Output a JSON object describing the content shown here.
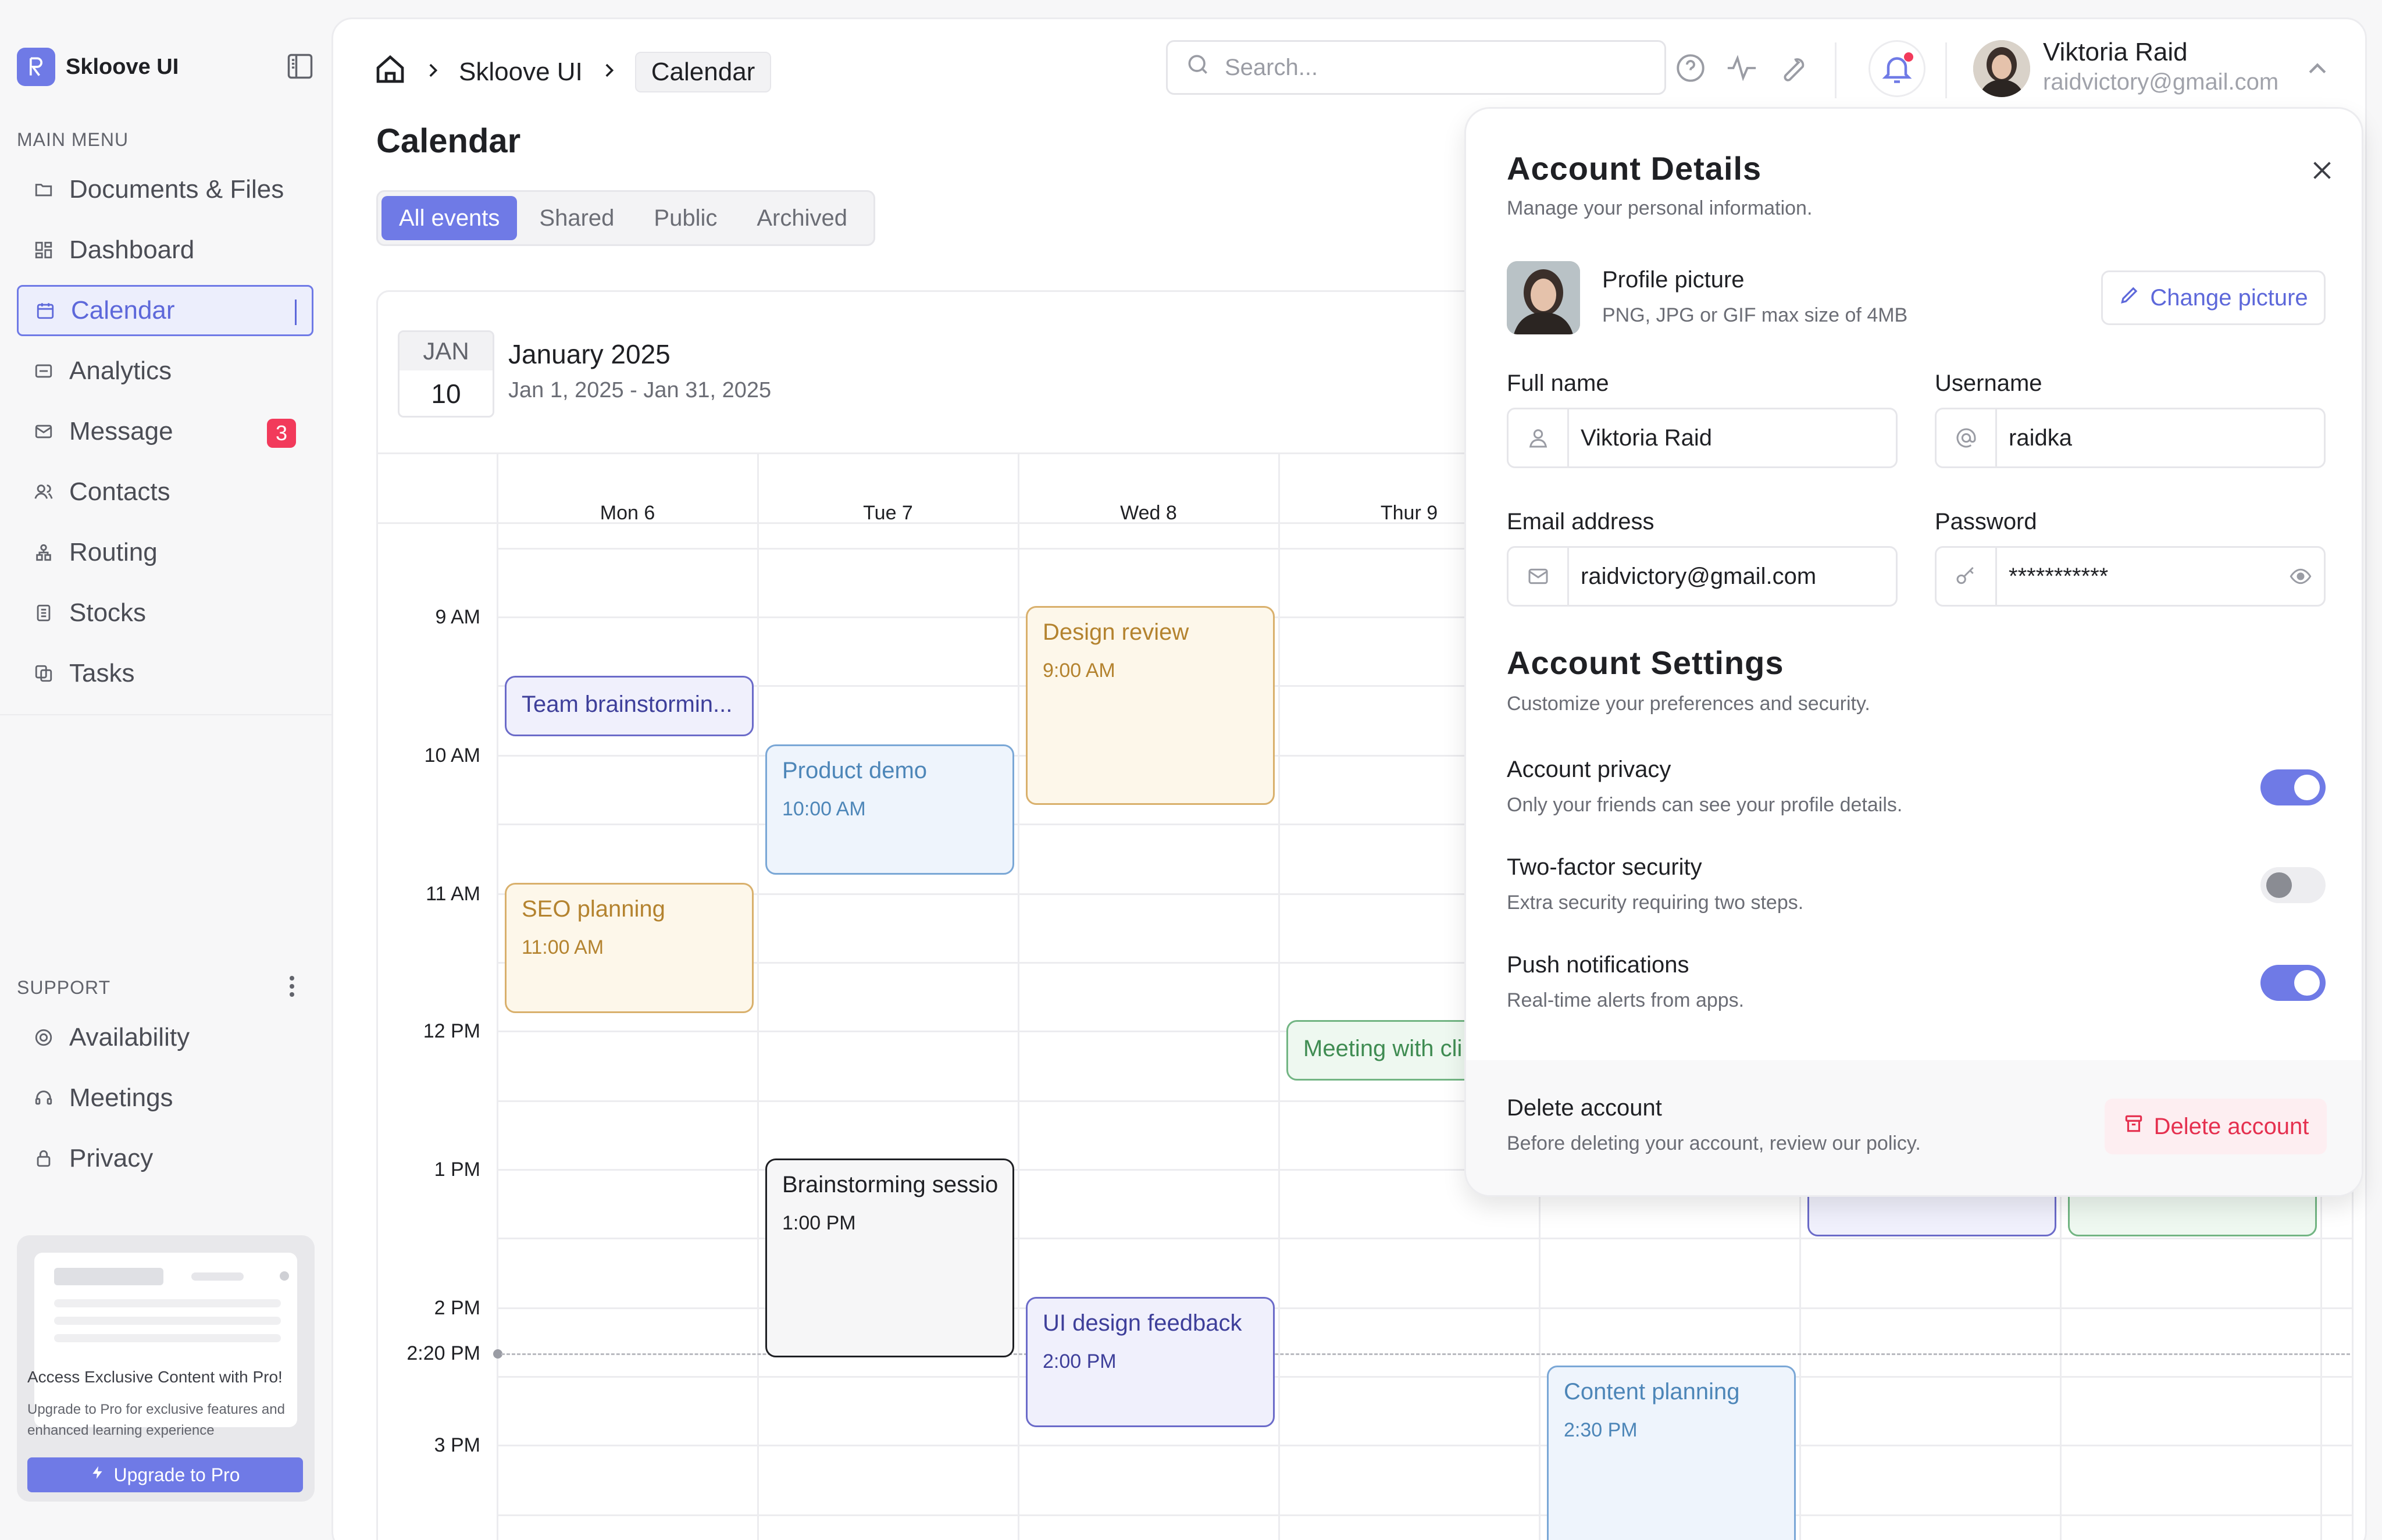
{
  "brand": {
    "name": "Skloove UI"
  },
  "sidebar": {
    "main_menu_label": "MAIN MENU",
    "items": [
      {
        "label": "Documents & Files",
        "icon": "folder-icon"
      },
      {
        "label": "Dashboard",
        "icon": "dashboard-icon"
      },
      {
        "label": "Calendar",
        "icon": "calendar-icon",
        "active": true
      },
      {
        "label": "Analytics",
        "icon": "analytics-icon"
      },
      {
        "label": "Message",
        "icon": "mail-icon",
        "badge": "3"
      },
      {
        "label": "Contacts",
        "icon": "contacts-icon"
      },
      {
        "label": "Routing",
        "icon": "routing-icon"
      },
      {
        "label": "Stocks",
        "icon": "stocks-icon"
      },
      {
        "label": "Tasks",
        "icon": "tasks-icon"
      }
    ],
    "support_label": "SUPPORT",
    "support_items": [
      {
        "label": "Availability",
        "icon": "availability-icon"
      },
      {
        "label": "Meetings",
        "icon": "meetings-icon"
      },
      {
        "label": "Privacy",
        "icon": "lock-icon"
      }
    ],
    "promo": {
      "title": "Access Exclusive Content with Pro!",
      "text": "Upgrade to Pro for exclusive features and enhanced learning experience",
      "button": "Upgrade to Pro"
    }
  },
  "header": {
    "breadcrumb": [
      "Skloove UI",
      "Calendar"
    ],
    "search_placeholder": "Search...",
    "user": {
      "name": "Viktoria Raid",
      "email": "raidvictory@gmail.com"
    }
  },
  "page": {
    "title": "Calendar",
    "tabs": [
      "All events",
      "Shared",
      "Public",
      "Archived"
    ],
    "active_tab": "All events"
  },
  "calendar": {
    "chip_month": "JAN",
    "chip_day": "10",
    "title": "January 2025",
    "range": "Jan 1, 2025 - Jan 31, 2025",
    "days": [
      "Mon 6",
      "Tue 7",
      "Wed 8",
      "Thur 9"
    ],
    "hours": [
      "9 AM",
      "10 AM",
      "11 AM",
      "12 PM",
      "1 PM",
      "2 PM",
      "3 PM"
    ],
    "now_label": "2:20 PM",
    "events": [
      {
        "title": "Team brainstormin...",
        "time": "",
        "color": "purple"
      },
      {
        "title": "Product demo",
        "time": "10:00 AM",
        "color": "blue"
      },
      {
        "title": "Design review",
        "time": "9:00 AM",
        "color": "orange"
      },
      {
        "title": "SEO planning",
        "time": "11:00 AM",
        "color": "orange"
      },
      {
        "title": "Meeting with cli",
        "time": "",
        "color": "green"
      },
      {
        "title": "Brainstorming session",
        "time": "1:00 PM",
        "color": "dark"
      },
      {
        "title": "UI design feedback",
        "time": "2:00 PM",
        "color": "purple"
      },
      {
        "title": "Content planning",
        "time": "2:30 PM",
        "color": "blue"
      }
    ]
  },
  "account": {
    "title": "Account Details",
    "subtitle": "Manage your personal information.",
    "profile_title": "Profile picture",
    "profile_hint": "PNG, JPG or GIF max size of 4MB",
    "change_picture": "Change picture",
    "full_name_label": "Full name",
    "full_name": "Viktoria Raid",
    "username_label": "Username",
    "username": "raidka",
    "email_label": "Email address",
    "email": "raidvictory@gmail.com",
    "password_label": "Password",
    "password": "***********",
    "settings_title": "Account Settings",
    "settings_subtitle": "Customize your preferences and security.",
    "settings": [
      {
        "title": "Account privacy",
        "desc": "Only your friends can see your profile details.",
        "enabled": true
      },
      {
        "title": "Two-factor security",
        "desc": "Extra security requiring two steps.",
        "enabled": false
      },
      {
        "title": "Push notifications",
        "desc": "Real-time alerts from apps.",
        "enabled": true
      }
    ],
    "delete_title": "Delete account",
    "delete_desc": "Before deleting your account, review our policy.",
    "delete_button": "Delete account"
  },
  "colors": {
    "accent": "#6f7ae6",
    "danger": "#e5304f",
    "badge": "#f23a5b"
  }
}
